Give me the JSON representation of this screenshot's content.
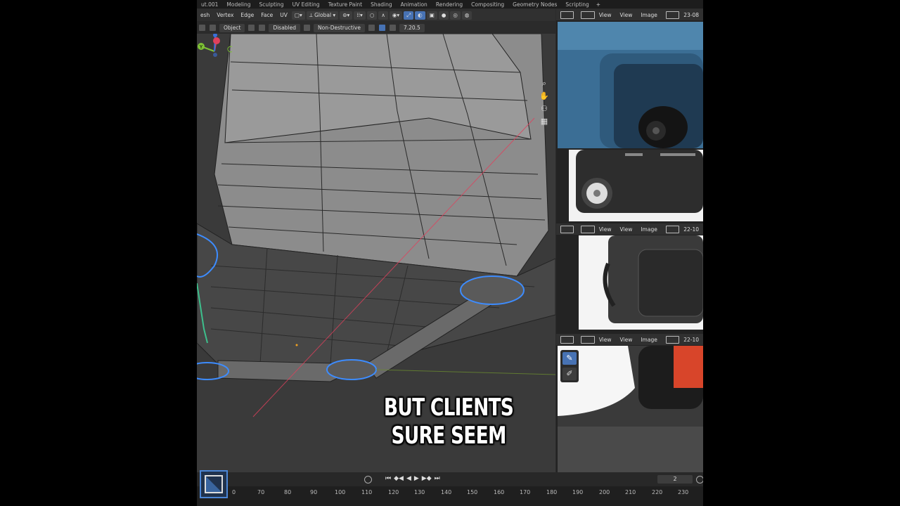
{
  "workspace_tabs": [
    "ut.001",
    "Modeling",
    "Sculpting",
    "UV Editing",
    "Texture Paint",
    "Shading",
    "Animation",
    "Rendering",
    "Compositing",
    "Geometry Nodes",
    "Scripting",
    "+"
  ],
  "header1": {
    "menus": [
      "esh",
      "Vertex",
      "Edge",
      "Face",
      "UV"
    ],
    "orientation": "Global"
  },
  "header2": {
    "mode": "Object",
    "snap": "Disabled",
    "destructive": "Non-Destructive",
    "value": "7.20.5"
  },
  "image_editors": [
    {
      "view": "View",
      "image": "Image",
      "name": "23-08"
    },
    {
      "view": "View",
      "image": "Image",
      "name": "22-10"
    },
    {
      "view": "View",
      "image": "Image",
      "name": "22-10"
    }
  ],
  "subtitle": "BUT CLIENTS SURE SEEM",
  "timeline": {
    "frame_numbers": [
      "0",
      "70",
      "80",
      "90",
      "100",
      "110",
      "120",
      "130",
      "140",
      "150",
      "160",
      "170",
      "180",
      "190",
      "200",
      "210",
      "220",
      "230"
    ],
    "current_frame": "2"
  },
  "gizmo_labels": {
    "y": "Y",
    "z": "Z"
  },
  "colors": {
    "accent": "#4772b3",
    "selection": "#3d8cff",
    "axis_x": "#e0405c",
    "axis_y": "#7ec235",
    "axis_z": "#3a70d9"
  }
}
